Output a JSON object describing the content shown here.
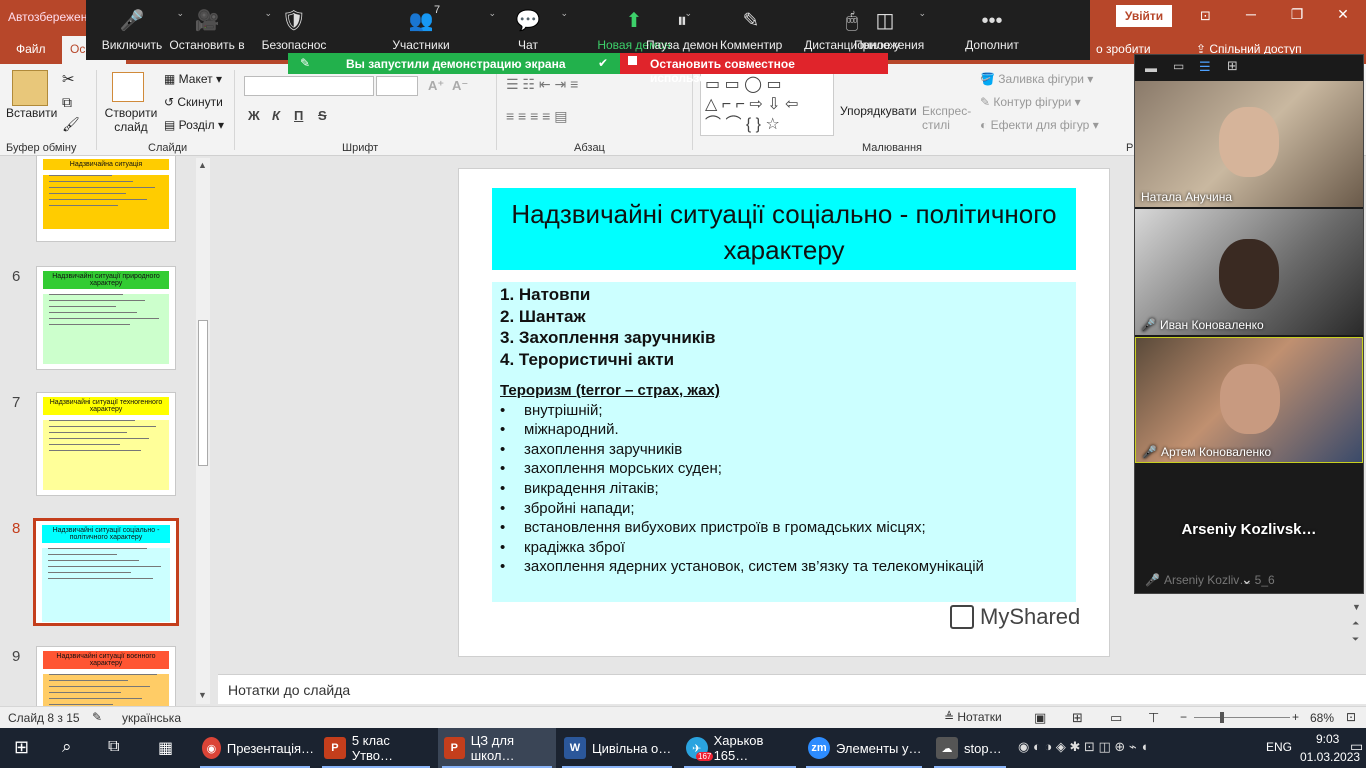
{
  "titlebar": {
    "autosave": "Автозбереження",
    "signin": "Увійти",
    "min": "─",
    "restore": "❐",
    "close": "✕"
  },
  "tabs": {
    "file": "Файл",
    "home": "Основне",
    "share": "Спільний доступ",
    "search_hint": "о зробити"
  },
  "ribbon": {
    "clipboard_group": "Буфер обміну",
    "paste": "Вставити",
    "slides_group": "Слайди",
    "new_slide": "Створити слайд",
    "layout": "Макет",
    "reset": "Скинути",
    "section": "Розділ",
    "font_group": "Шрифт",
    "font_name": "",
    "font_size": "",
    "bold": "Ж",
    "italic": "К",
    "underline": "П",
    "strike": "S",
    "paragraph_group": "Абзац",
    "drawing_group": "Малювання",
    "arrange": "Упорядкувати",
    "quick_styles": "Експрес-стилі",
    "fill": "Заливка фігури",
    "outline": "Контур фігури",
    "effects": "Ефекти для фігур",
    "editing_group": "Р"
  },
  "zoom": {
    "buttons": [
      {
        "label": "Виключить",
        "icon": "🎤"
      },
      {
        "label": "Остановить в",
        "icon": "🎥"
      },
      {
        "label": "Безопаснос",
        "icon": "🛡"
      },
      {
        "label": "Участники",
        "icon": "👥",
        "count": "7"
      },
      {
        "label": "Чат",
        "icon": "💬"
      },
      {
        "label": "Новая демон",
        "icon": "⬆"
      },
      {
        "label": "Пауза демон",
        "icon": "⏸"
      },
      {
        "label": "Комментир",
        "icon": "✎"
      },
      {
        "label": "Дистанционное у",
        "icon": "🖱"
      },
      {
        "label": "Приложения",
        "icon": "◫"
      },
      {
        "label": "Дополнит",
        "icon": "•••"
      }
    ],
    "sharing_notice": "Вы запустили демонстрацию экрана",
    "stop_share": "Остановить совместное использование"
  },
  "thumbs": [
    {
      "num": "",
      "title": "Надзвичайна ситуація",
      "color": "#ffcc00"
    },
    {
      "num": "6",
      "title": "Надзвичайні ситуації природного характеру",
      "color": "#33cc33"
    },
    {
      "num": "7",
      "title": "Надзвичайні ситуації техногенного характеру",
      "color": "#ffff00"
    },
    {
      "num": "8",
      "title": "Надзвичайні ситуації соціально - політичного характеру",
      "color": "#00ffff"
    },
    {
      "num": "9",
      "title": "Надзвичайні ситуації воєнного характеру",
      "color": "#ff5533"
    }
  ],
  "slide": {
    "title": "Надзвичайні ситуації соціально - політичного характеру",
    "items": [
      "1. Натовпи",
      "2. Шантаж",
      "3. Захоплення заручників",
      "4. Терористичні акти"
    ],
    "term": "Тероризм  (terror – страх, жах)",
    "bullet": "•",
    "bullets": [
      "внутрішній;",
      "міжнародний.",
      "захоплення заручників",
      "захоплення морських суден;",
      "викрадення літаків;",
      "збройні напади;",
      "встановлення вибухових пристроїв в громадських місцях;",
      "крадіжка зброї",
      "захоплення ядерних установок, систем зв’язку та телекомунікацій"
    ],
    "watermark": "MyShared"
  },
  "notes": "Нотатки до слайда",
  "status": {
    "slide": "Слайд 8 з 15",
    "lang": "українська",
    "notes_btn": "Нотатки",
    "zoom": "68%"
  },
  "participants": [
    {
      "name": "Натала Анучина",
      "muted": false
    },
    {
      "name": "Иван Коноваленко",
      "muted": true
    },
    {
      "name": "Артем Коноваленко",
      "muted": true
    },
    {
      "name": "Arseniy  Kozlivsk…",
      "muted": false
    },
    {
      "name": "Arseniy Kozliv… 5_6",
      "muted": true
    }
  ],
  "taskbar": {
    "items": [
      {
        "label": "Презентація…",
        "color": "#db4437",
        "icon": "◉"
      },
      {
        "label": "5 клас Утво…",
        "color": "#c43e1c",
        "icon": "P"
      },
      {
        "label": "ЦЗ для школ…",
        "color": "#c43e1c",
        "icon": "P"
      },
      {
        "label": "Цивільна о…",
        "color": "#2b579a",
        "icon": "W"
      },
      {
        "label": "Харьков 165…",
        "color": "#2aa3df",
        "icon": "✈",
        "badge": "167"
      },
      {
        "label": "Элементы у…",
        "color": "#2d8cff",
        "icon": "zm"
      },
      {
        "label": "stop…",
        "color": "#555",
        "icon": "☁"
      }
    ],
    "lang": "ENG",
    "time": "9:03",
    "date": "01.03.2023"
  }
}
